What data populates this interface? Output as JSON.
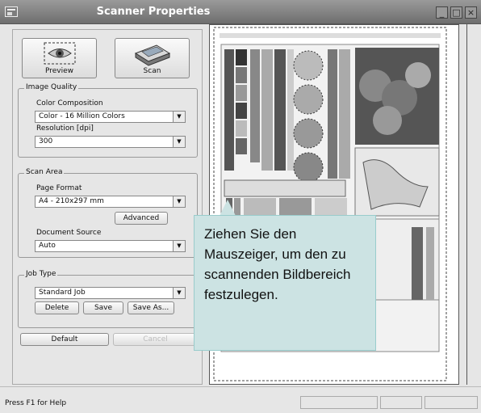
{
  "window": {
    "title": "Scanner Properties",
    "minimize": "_",
    "maximize": "□",
    "close": "×"
  },
  "actions": {
    "preview_label": "Preview",
    "scan_label": "Scan"
  },
  "image_quality": {
    "group_label": "Image Quality",
    "color_label": "Color Composition",
    "color_value": "Color - 16 Million Colors",
    "resolution_label": "Resolution [dpi]",
    "resolution_value": "300"
  },
  "scan_area": {
    "group_label": "Scan Area",
    "page_format_label": "Page Format",
    "page_format_value": "A4 - 210x297 mm",
    "advanced_label": "Advanced",
    "document_source_label": "Document Source",
    "document_source_value": "Auto"
  },
  "job_type": {
    "group_label": "Job Type",
    "value": "Standard Job",
    "delete_label": "Delete",
    "save_label": "Save",
    "save_as_label": "Save As..."
  },
  "bottom": {
    "default_label": "Default",
    "cancel_label": "Cancel"
  },
  "status": {
    "text": "Press F1 for Help"
  },
  "tooltip": {
    "text": "Ziehen Sie den Mauszeiger, um den zu scannenden Bildbereich festzulegen."
  }
}
